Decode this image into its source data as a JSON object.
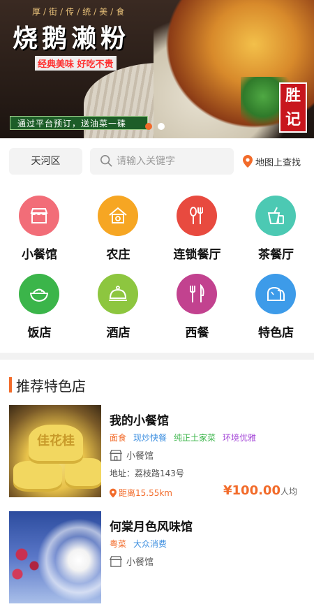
{
  "banner": {
    "tagline": "厚/街/传/统/美/食",
    "title": "烧鹅濑粉",
    "slogan": "经典美味 好吃不贵",
    "notice": "通过平台预订，送油菜一碟",
    "brand": "胜记",
    "slide_active_index": 0,
    "slide_count": 2
  },
  "search": {
    "district": "天河区",
    "placeholder": "请输入关键字",
    "map_label": "地图上查找"
  },
  "categories": [
    {
      "label": "小餐馆",
      "icon": "store-icon",
      "color": "#f26d78"
    },
    {
      "label": "农庄",
      "icon": "farmhouse-icon",
      "color": "#f6a623"
    },
    {
      "label": "连锁餐厅",
      "icon": "cutlery-icon",
      "color": "#e84a3f"
    },
    {
      "label": "茶餐厅",
      "icon": "drink-icon",
      "color": "#4cc9b3"
    },
    {
      "label": "饭店",
      "icon": "rice-bowl-icon",
      "color": "#3bb54a"
    },
    {
      "label": "酒店",
      "icon": "cloche-icon",
      "color": "#8dc63f"
    },
    {
      "label": "西餐",
      "icon": "fork-knife-icon",
      "color": "#c2428f"
    },
    {
      "label": "特色店",
      "icon": "bread-icon",
      "color": "#3d9be9"
    }
  ],
  "section": {
    "title": "推荐特色店"
  },
  "shops": [
    {
      "name": "我的小餐馆",
      "tags": [
        {
          "text": "面食",
          "color": "#f26b2a"
        },
        {
          "text": "现炒快餐",
          "color": "#3d8fe0"
        },
        {
          "text": "纯正土家菜",
          "color": "#3bb54a"
        },
        {
          "text": "环境优雅",
          "color": "#a64ad8"
        }
      ],
      "type": "小餐馆",
      "address": "地址：荔枝路143号",
      "distance": "距离15.55km",
      "price": "¥100.00",
      "price_unit": "人均",
      "thumb_text": "佳花桂"
    },
    {
      "name": "何棠月色风味馆",
      "tags": [
        {
          "text": "粤菜",
          "color": "#f26b2a"
        },
        {
          "text": "大众消费",
          "color": "#3d8fe0"
        }
      ],
      "type": "小餐馆"
    }
  ],
  "colors": {
    "accent": "#f26b2a",
    "background": "#ffffff",
    "input_bg": "#f3f3f3"
  }
}
